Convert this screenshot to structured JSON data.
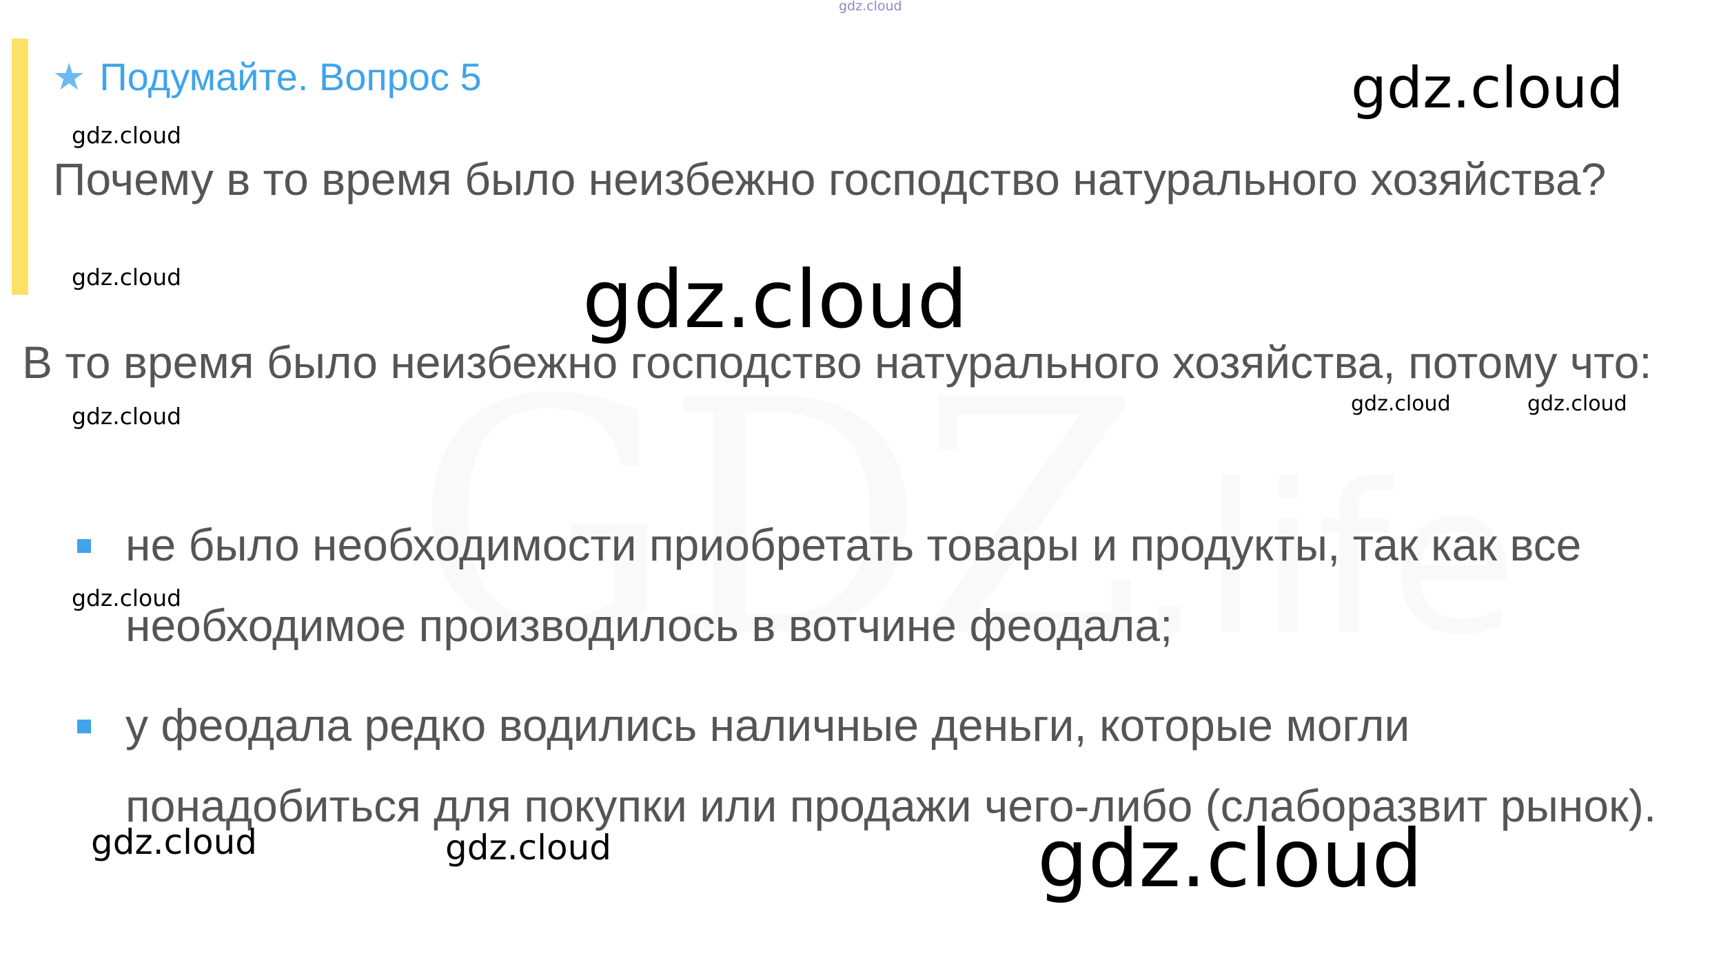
{
  "background_watermark": {
    "main": "GDZ",
    "suffix": ".life"
  },
  "top_watermark": "gdz.cloud",
  "question": {
    "icon": "star-icon",
    "title": "Подумайте. Вопрос 5",
    "text": "Почему в то время было неизбежно господство натурального хозяйства?"
  },
  "answer": {
    "intro": "В то время было неизбежно господство натурального хозяйства, потому что:",
    "bullets": [
      "не было необходимости приобретать товары и продукты, так как все необходимое производилось в вотчине феодала;",
      "у феодала редко водились наличные деньги, которые могли понадобиться для покупки или продажи чего-либо (слаборазвит рынок)."
    ]
  },
  "watermarks": [
    "gdz.cloud",
    "gdz.cloud",
    "gdz.cloud",
    "gdz.cloud",
    "gdz.cloud",
    "gdz.cloud",
    "gdz.cloud",
    "gdz.cloud",
    "gdz.cloud",
    "gdz.cloud",
    "gdz.cloud"
  ],
  "colors": {
    "accent_blue": "#3fa4ea",
    "bar_yellow": "#fde166",
    "text_gray": "#555555"
  }
}
